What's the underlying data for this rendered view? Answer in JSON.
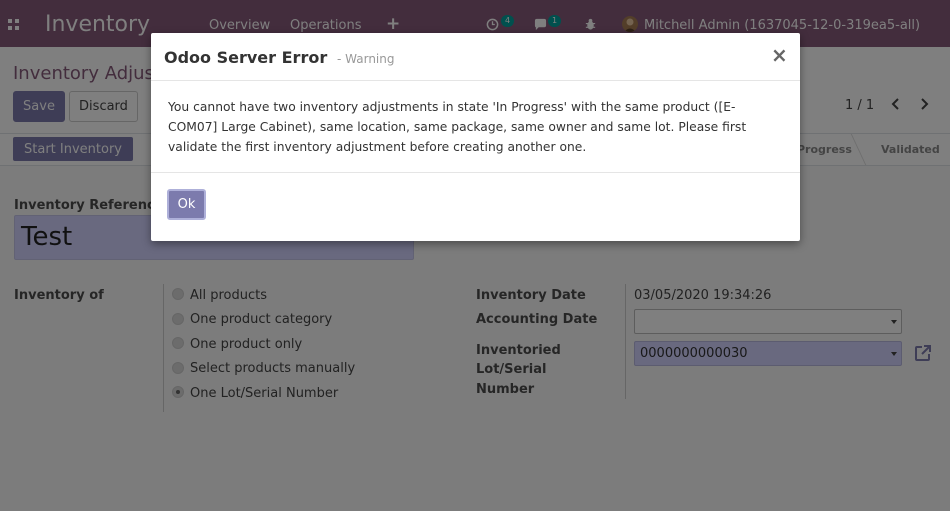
{
  "navbar": {
    "app_title": "Inventory",
    "menu": [
      "Overview",
      "Operations"
    ],
    "plus": "+",
    "activity_count": "4",
    "message_count": "1",
    "user": "Mitchell Admin (1637045-12-0-319ea5-all)"
  },
  "control_panel": {
    "breadcrumb": "Inventory Adjus",
    "save_label": "Save",
    "discard_label": "Discard",
    "pager": "1 / 1"
  },
  "statusbar": {
    "start_button": "Start Inventory",
    "stages": [
      "Progress",
      "Validated"
    ]
  },
  "form": {
    "reference_label": "Inventory Reference",
    "reference_value": "Test",
    "inventory_of_label": "Inventory of",
    "options": [
      {
        "label": "All products",
        "checked": false
      },
      {
        "label": "One product category",
        "checked": false
      },
      {
        "label": "One product only",
        "checked": false
      },
      {
        "label": "Select products manually",
        "checked": false
      },
      {
        "label": "One Lot/Serial Number",
        "checked": true
      }
    ],
    "inventory_date_label": "Inventory Date",
    "inventory_date_value": "03/05/2020 19:34:26",
    "accounting_date_label": "Accounting Date",
    "accounting_date_value": "",
    "lot_label_lines": [
      "Inventoried",
      "Lot/Serial",
      "Number"
    ],
    "lot_value": "0000000000030"
  },
  "dialog": {
    "title": "Odoo Server Error",
    "subtitle": "- Warning",
    "close": "×",
    "message_lines": [
      "You cannot have two inventory adjustments in state 'In Progress' with the same product ([E-",
      "COM07] Large Cabinet), same location, same package, same owner and same lot. Please first",
      "validate the first inventory adjustment before creating another one."
    ],
    "ok_label": "Ok"
  },
  "colors": {
    "navbar": "#875a7b",
    "primary": "#7c7bad",
    "required_field": "#d2d2ff",
    "badge": "#00a09d"
  }
}
